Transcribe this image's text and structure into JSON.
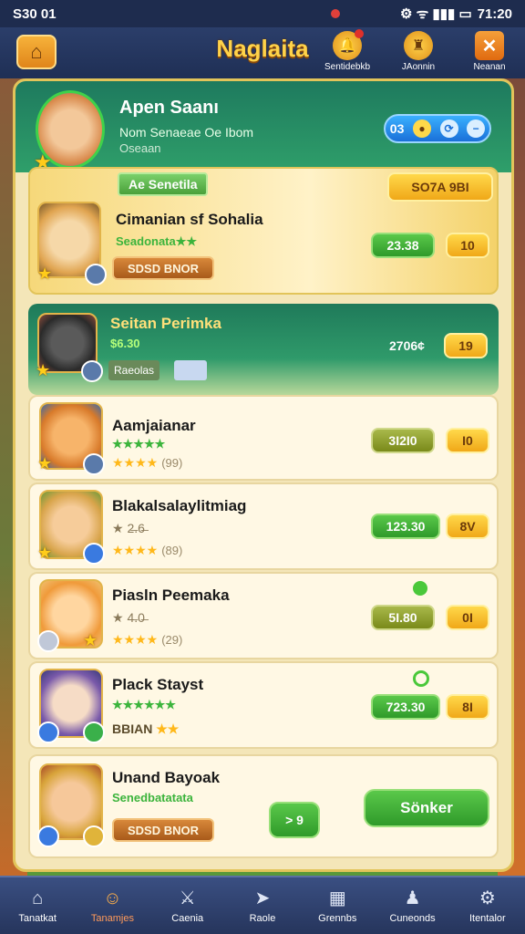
{
  "status": {
    "left": "S30 01",
    "time": "71:20"
  },
  "header": {
    "title": "Naglaita",
    "icons": [
      {
        "label": "Sentidebkb",
        "icon": "bell-icon"
      },
      {
        "label": "JAonnin",
        "icon": "trophy-icon"
      },
      {
        "label": "Neanan",
        "icon": "close-icon"
      }
    ]
  },
  "player": {
    "name": "Apen Saanı",
    "sub": "Nom Senaeae Oe Ibom",
    "sub2": "Oseaan",
    "pill_value": "03"
  },
  "section_tag": "Ae Senetila",
  "rows": [
    {
      "name": "Cimanian sf Sohalia",
      "sub": "Seadonata★★",
      "button": "SDSD BNOR",
      "value": "23.38",
      "badge": "10",
      "top_value": "SO7A  9BI"
    },
    {
      "name": "Seitan Perimka",
      "sub": "$6.30",
      "button": "Raeolas",
      "value": "2706¢",
      "badge": "19"
    },
    {
      "name": "Aamjaianar",
      "sub": "★★★★★",
      "stars": "★★★★",
      "count": "(99)",
      "value": "3I2I0",
      "badge": "I0"
    },
    {
      "name": "Blakalsalaylitmiag",
      "sub": "★ 2̶.6̶",
      "stars": "★★★★",
      "count": "(89)",
      "value": "123.30",
      "badge": "8V"
    },
    {
      "name": "Piasln Peemaka",
      "sub": "★ 4̶.0̶",
      "stars": "★★★★",
      "count": "(29)",
      "value": "5I.80",
      "badge": "0I"
    },
    {
      "name": "Plack Stayst",
      "sub": "★★★★★★",
      "stars_text": "BBIAN",
      "value": "723.30",
      "badge": "8I"
    },
    {
      "name": "Unand Bayoak",
      "sub": "Senedbatatata",
      "button": "SDSD BNOR",
      "action": "Sönker",
      "arrow": "> 9"
    }
  ],
  "nav": [
    {
      "label": "Tanatkat",
      "icon": "home-icon"
    },
    {
      "label": "Tanamjes",
      "icon": "profile-icon"
    },
    {
      "label": "Caenia",
      "icon": "sword-icon"
    },
    {
      "label": "Raole",
      "icon": "map-icon"
    },
    {
      "label": "Grennbs",
      "icon": "grid-icon"
    },
    {
      "label": "Cuneonds",
      "icon": "user-icon"
    },
    {
      "label": "Itentalor",
      "icon": "gear-icon"
    }
  ]
}
